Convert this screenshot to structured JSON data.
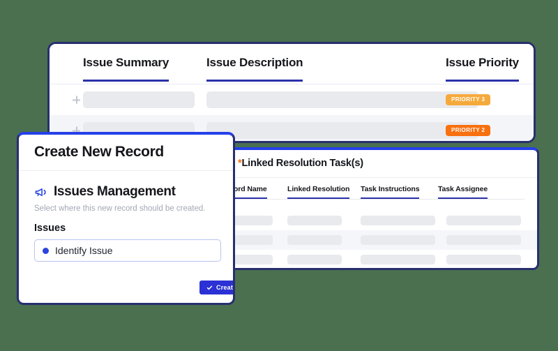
{
  "theme": {
    "background": "#4a7050",
    "card_border": "#282f6e",
    "accent_blue": "#2540e8",
    "header_underline": "#2b31a8",
    "skeleton": "#e9eaee",
    "required_star": "#f2700f"
  },
  "issues_table": {
    "columns": [
      {
        "label": "Issue Summary"
      },
      {
        "label": "Issue Description"
      },
      {
        "label": "Issue Priority"
      }
    ],
    "rows": [
      {
        "expand_icon": "plus-icon",
        "summary": "",
        "description": "",
        "priority": "PRIORITY 3",
        "priority_color": "#f6a93b"
      },
      {
        "expand_icon": "plus-icon",
        "summary": "",
        "description": "",
        "priority": "PRIORITY 2",
        "priority_color": "#f9700f"
      }
    ]
  },
  "linked_panel": {
    "icon": "bookmark-icon",
    "required_marker": "*",
    "title": "Linked Resolution Task(s)",
    "columns": [
      {
        "label": "Record Name"
      },
      {
        "label": "Linked Resolution"
      },
      {
        "label": "Task Instructions"
      },
      {
        "label": "Task Assignee"
      }
    ],
    "rows": [
      {
        "record_name": "",
        "linked_resolution": "",
        "task_instructions": "",
        "task_assignee": ""
      },
      {
        "record_name": "",
        "linked_resolution": "",
        "task_instructions": "",
        "task_assignee": ""
      },
      {
        "record_name": "",
        "linked_resolution": "",
        "task_instructions": "",
        "task_assignee": ""
      }
    ]
  },
  "create_record": {
    "title": "Create New Record",
    "section_icon": "megaphone-icon",
    "section_title": "Issues Management",
    "section_subtitle": "Select where this new record should be created.",
    "field_label": "Issues",
    "select_value": "Identify Issue",
    "submit_icon": "check-icon",
    "submit_label": "Create"
  }
}
